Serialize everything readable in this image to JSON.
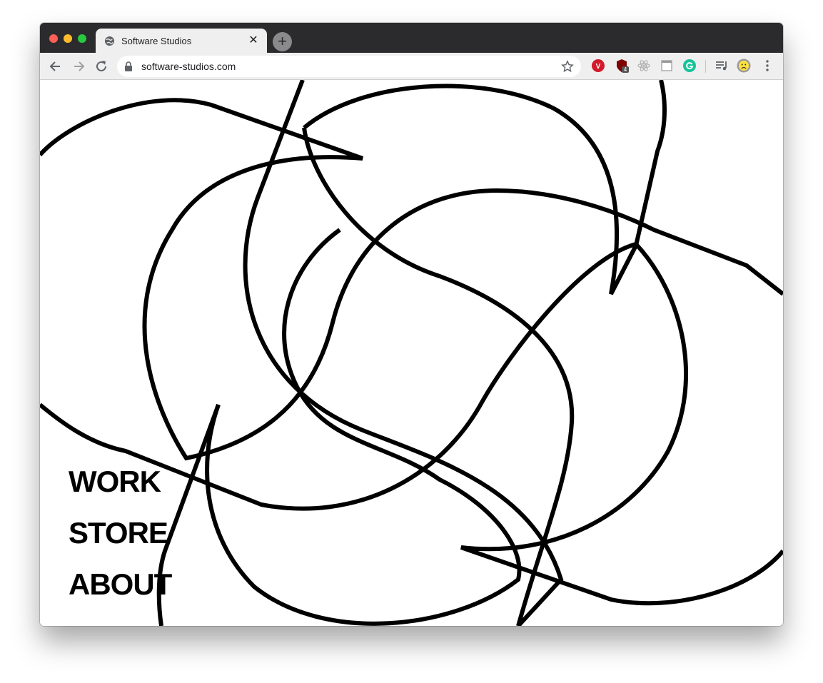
{
  "browser": {
    "tab": {
      "title": "Software Studios",
      "favicon": "globe-icon",
      "close_icon": "close-icon"
    },
    "new_tab_icon": "plus-icon",
    "toolbar": {
      "back_icon": "back-arrow-icon",
      "forward_icon": "forward-arrow-icon",
      "reload_icon": "reload-icon",
      "address": "software-studios.com",
      "lock_icon": "lock-icon",
      "bookmark_icon": "star-icon",
      "extensions": [
        {
          "name": "vpn-extension-icon"
        },
        {
          "name": "ublock-extension-icon",
          "badge": "4"
        },
        {
          "name": "react-devtools-icon"
        },
        {
          "name": "window-extension-icon"
        },
        {
          "name": "grammarly-icon"
        },
        {
          "name": "playlist-icon"
        },
        {
          "name": "profile-avatar-icon"
        },
        {
          "name": "more-menu-icon"
        }
      ]
    }
  },
  "page": {
    "nav": {
      "work": "WORK",
      "store": "STORE",
      "about": "ABOUT"
    }
  },
  "colors": {
    "traffic_red": "#fe5f57",
    "traffic_yellow": "#febc2e",
    "traffic_green": "#28c840",
    "tabstrip": "#2b2b2d",
    "toolbar": "#efefef",
    "ink": "#000000"
  }
}
